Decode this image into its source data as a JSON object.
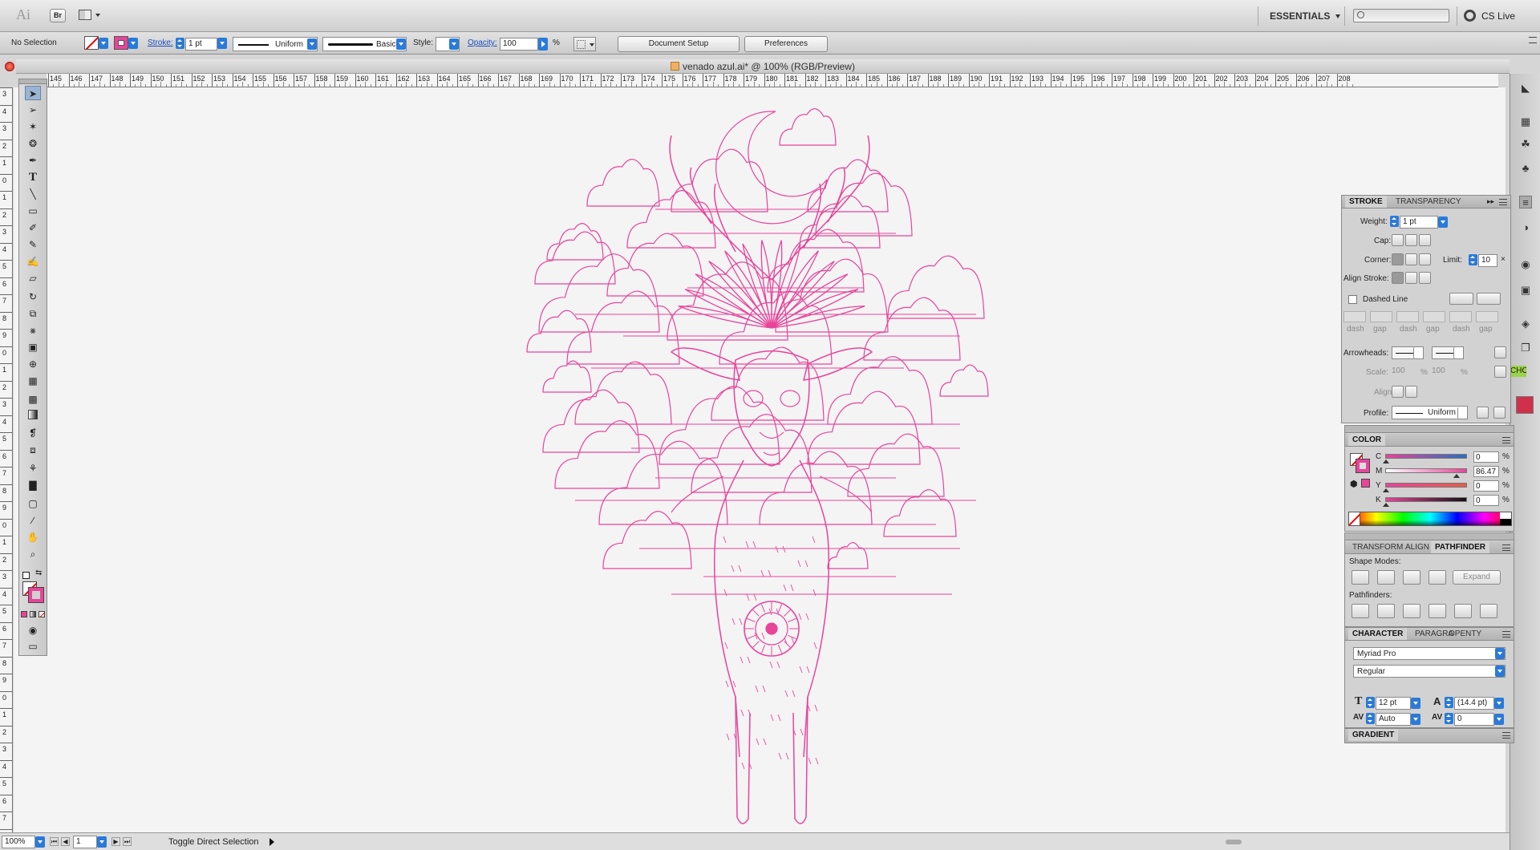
{
  "app": {
    "logo": "Ai",
    "bridge_label": "Br",
    "workspace": "ESSENTIALS",
    "search_placeholder": "",
    "cs_live": "CS Live"
  },
  "control_bar": {
    "selection": "No Selection",
    "stroke_label": "Stroke:",
    "stroke_value": "1 pt",
    "profile_value": "Uniform",
    "brush_value": "Basic",
    "style_label": "Style:",
    "opacity_label": "Opacity:",
    "opacity_value": "100",
    "opacity_unit": "%",
    "document_setup": "Document Setup",
    "preferences": "Preferences"
  },
  "document": {
    "title": "venado azul.ai* @ 100% (RGB/Preview)",
    "ruler_top": [
      "145",
      "146",
      "147",
      "148",
      "149",
      "150",
      "151",
      "152",
      "153",
      "154",
      "155",
      "156",
      "157",
      "158",
      "159",
      "160",
      "161",
      "162",
      "163",
      "164",
      "165",
      "166",
      "167",
      "168",
      "169",
      "170",
      "171",
      "172",
      "173",
      "174",
      "175",
      "176",
      "177",
      "178",
      "179",
      "180",
      "181",
      "182",
      "183",
      "184",
      "185",
      "186",
      "187",
      "188",
      "189",
      "190",
      "191",
      "192",
      "193",
      "194",
      "195",
      "196",
      "197",
      "198",
      "199",
      "200",
      "201",
      "202",
      "203",
      "204",
      "205",
      "206",
      "207",
      "208"
    ],
    "ruler_left": [
      "3",
      "4",
      "3",
      "2",
      "1",
      "0",
      "1",
      "2",
      "3",
      "4",
      "5",
      "6",
      "7",
      "8",
      "9",
      "0",
      "1",
      "2",
      "3",
      "4",
      "5",
      "6",
      "7",
      "8",
      "9",
      "0",
      "1",
      "2",
      "3",
      "4",
      "5",
      "6",
      "7",
      "8",
      "9",
      "0",
      "1",
      "2",
      "3",
      "4",
      "5",
      "6",
      "7",
      "8"
    ],
    "artwork_color": "#e8449a"
  },
  "status": {
    "zoom": "100%",
    "page": "1",
    "tool_hint": "Toggle Direct Selection"
  },
  "stroke_panel": {
    "tab_stroke": "STROKE",
    "tab_transparency": "TRANSPARENCY",
    "weight_label": "Weight:",
    "weight_value": "1 pt",
    "cap_label": "Cap:",
    "corner_label": "Corner:",
    "limit_label": "Limit:",
    "limit_value": "10",
    "align_label": "Align Stroke:",
    "dashed_label": "Dashed Line",
    "dash_labels": [
      "dash",
      "gap",
      "dash",
      "gap",
      "dash",
      "gap"
    ],
    "arrowheads_label": "Arrowheads:",
    "scale_label": "Scale:",
    "scale_start": "100",
    "scale_end": "100",
    "percent": "%",
    "align_arrow_label": "Align:",
    "profile_label": "Profile:",
    "profile_value": "Uniform"
  },
  "color_panel": {
    "title": "COLOR",
    "channels": [
      {
        "label": "C",
        "value": "0"
      },
      {
        "label": "M",
        "value": "86.47"
      },
      {
        "label": "Y",
        "value": "0"
      },
      {
        "label": "K",
        "value": "0"
      }
    ],
    "percent": "%",
    "stroke_color": "#e8449a"
  },
  "pathfinder_panel": {
    "tab_transform": "TRANSFORM",
    "tab_align": "ALIGN",
    "tab_pathfinder": "PATHFINDER",
    "shape_modes_label": "Shape Modes:",
    "expand_label": "Expand",
    "pathfinders_label": "Pathfinders:"
  },
  "character_panel": {
    "tab_character": "CHARACTER",
    "tab_paragraph": "PARAGRA",
    "tab_opentype": "OPENTY",
    "font_family": "Myriad Pro",
    "font_style": "Regular",
    "font_size": "12 pt",
    "leading": "(14.4 pt)",
    "kerning": "Auto",
    "tracking": "0"
  },
  "gradient_panel": {
    "title": "GRADIENT"
  },
  "dock_hint": "CHO"
}
